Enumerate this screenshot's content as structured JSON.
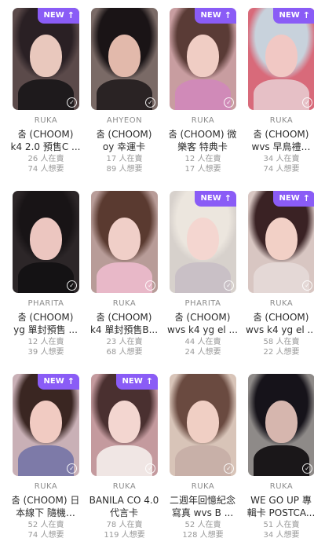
{
  "cards": [
    {
      "new": true,
      "owner": "RUKA",
      "title1": "춤 (CHOOM)",
      "title2": "k4 2.0 預售C ...",
      "seller": "26 人在賣",
      "want": "74 人想要",
      "hair": "#2a2024",
      "skin": "#e9c8bd",
      "bg": "#5b4a4a",
      "cloth": "#1e1a1c"
    },
    {
      "new": false,
      "owner": "AHYEON",
      "title1": "춤 (CHOOM)",
      "title2": "oy 幸運卡",
      "seller": "17 人在賣",
      "want": "89 人想要",
      "hair": "#1a1416",
      "skin": "#e2b9ab",
      "bg": "#7a6a66",
      "cloth": "#2a2324"
    },
    {
      "new": true,
      "owner": "RUKA",
      "title1": "춤 (CHOOM) 微",
      "title2": "樂客 特典卡",
      "seller": "12 人在賣",
      "want": "17 人想要",
      "hair": "#5a3b36",
      "skin": "#f0cdc4",
      "bg": "#c89da0",
      "cloth": "#d08ab8"
    },
    {
      "new": true,
      "owner": "RUKA",
      "title1": "춤 (CHOOM)",
      "title2": "wvs 早鳥禮…",
      "seller": "34 人在賣",
      "want": "74 人想要",
      "hair": "#c8d2dc",
      "skin": "#f1c8c4",
      "bg": "#d86a7a",
      "cloth": "#e6c0c6"
    },
    {
      "new": false,
      "owner": "PHARITA",
      "title1": "춤 (CHOOM)",
      "title2": "yg 單封預售 ...",
      "seller": "12 人在賣",
      "want": "39 人想要",
      "hair": "#181416",
      "skin": "#ecc6c0",
      "bg": "#2c2628",
      "cloth": "#141214"
    },
    {
      "new": false,
      "owner": "RUKA",
      "title1": "춤 (CHOOM)",
      "title2": "k4 單封預售B...",
      "seller": "23 人在賣",
      "want": "68 人想要",
      "hair": "#5a3a30",
      "skin": "#f0cfc8",
      "bg": "#b89c98",
      "cloth": "#e8b8c8"
    },
    {
      "new": true,
      "owner": "PHARITA",
      "title1": "춤 (CHOOM)",
      "title2": "wvs k4 yg el ...",
      "seller": "44 人在賣",
      "want": "24 人想要",
      "hair": "#ece6de",
      "skin": "#f4d6d0",
      "bg": "#d7d1cc",
      "cloth": "#c9c0c6"
    },
    {
      "new": true,
      "owner": "RUKA",
      "title1": "춤 (CHOOM)",
      "title2": "wvs k4 yg el ...",
      "seller": "58 人在賣",
      "want": "22 人想要",
      "hair": "#3a2224",
      "skin": "#f2d0c6",
      "bg": "#d8c6c2",
      "cloth": "#e4d8d6"
    },
    {
      "new": true,
      "owner": "RUKA",
      "title1": "춤 (CHOOM) 日",
      "title2": "本線下 隨機…",
      "seller": "52 人在賣",
      "want": "74 人想要",
      "hair": "#3a2622",
      "skin": "#f1cbc2",
      "bg": "#c9b0b6",
      "cloth": "#7d7aa8"
    },
    {
      "new": true,
      "owner": "RUKA",
      "title1": "BANILA CO 4.0",
      "title2": "代言卡",
      "seller": "78 人在賣",
      "want": "119 人想要",
      "hair": "#4a3030",
      "skin": "#f3d6d0",
      "bg": "#c49a9e",
      "cloth": "#f0e6e4"
    },
    {
      "new": false,
      "owner": "RUKA",
      "title1": "二週年回憶紀念",
      "title2": "寫真 wvs B ...",
      "seller": "52 人在賣",
      "want": "128 人想要",
      "hair": "#6a4a40",
      "skin": "#f0cfc4",
      "bg": "#d8c4b8",
      "cloth": "#c8b0a8"
    },
    {
      "new": false,
      "owner": "RUKA",
      "title1": "WE GO UP 專",
      "title2": "輯卡 POSTCA...",
      "seller": "51 人在賣",
      "want": "34 人想要",
      "hair": "#16131a",
      "skin": "#d6b6ae",
      "bg": "#8e8a88",
      "cloth": "#1a1719"
    }
  ],
  "labels": {
    "new_badge": "NEW",
    "new_arrow": "↑",
    "check_mark": "✓"
  }
}
